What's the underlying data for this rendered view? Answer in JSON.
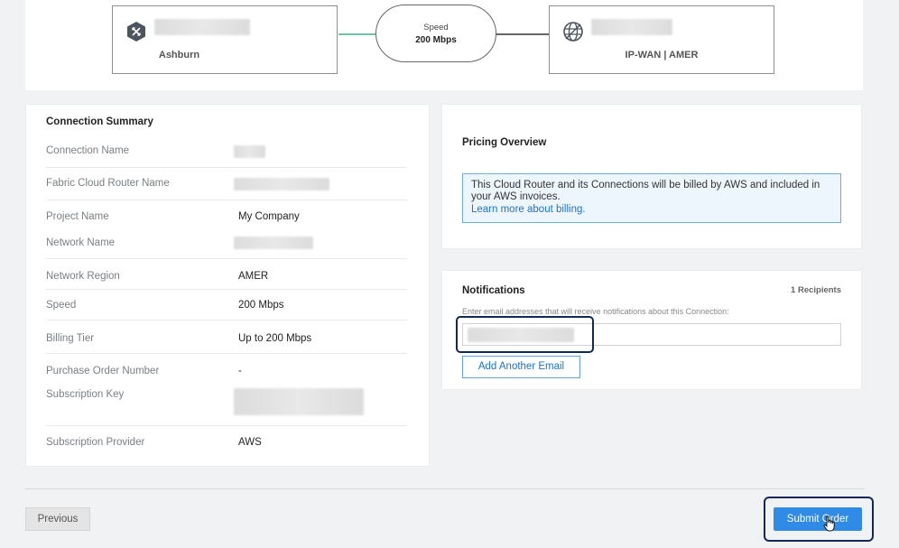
{
  "topology": {
    "source": {
      "label": "Ashburn",
      "icon": "router-icon"
    },
    "link": {
      "title": "Speed",
      "value": "200 Mbps"
    },
    "destination": {
      "label": "IP-WAN | AMER",
      "icon": "globe-icon"
    }
  },
  "summary": {
    "title": "Connection Summary",
    "rows": [
      {
        "key": "Connection Name",
        "value": ""
      },
      {
        "key": "Fabric Cloud Router Name",
        "value": ""
      },
      {
        "key": "Project Name",
        "value": "My Company"
      },
      {
        "key": "Network Name",
        "value": ""
      },
      {
        "key": "Network Region",
        "value": "AMER"
      },
      {
        "key": "Speed",
        "value": "200 Mbps"
      },
      {
        "key": "Billing Tier",
        "value": "Up to 200 Mbps"
      },
      {
        "key": "Purchase Order Number",
        "value": "-"
      },
      {
        "key": "Subscription Key",
        "value": ""
      },
      {
        "key": "Subscription Provider",
        "value": "AWS"
      }
    ]
  },
  "pricing": {
    "title": "Pricing Overview",
    "info": "This Cloud Router and its Connections will be billed by AWS and included in your AWS invoices.",
    "link": "Learn more about billing."
  },
  "notifications": {
    "title": "Notifications",
    "recipients": "1 Recipients",
    "hint": "Enter email addresses that will receive notifications about this Connection:",
    "add_button": "Add Another Email"
  },
  "footer": {
    "previous": "Previous",
    "submit": "Submit Order"
  },
  "colors": {
    "accent": "#2f8be6",
    "highlight": "#12285a",
    "link_line": "#6cc3a8"
  }
}
